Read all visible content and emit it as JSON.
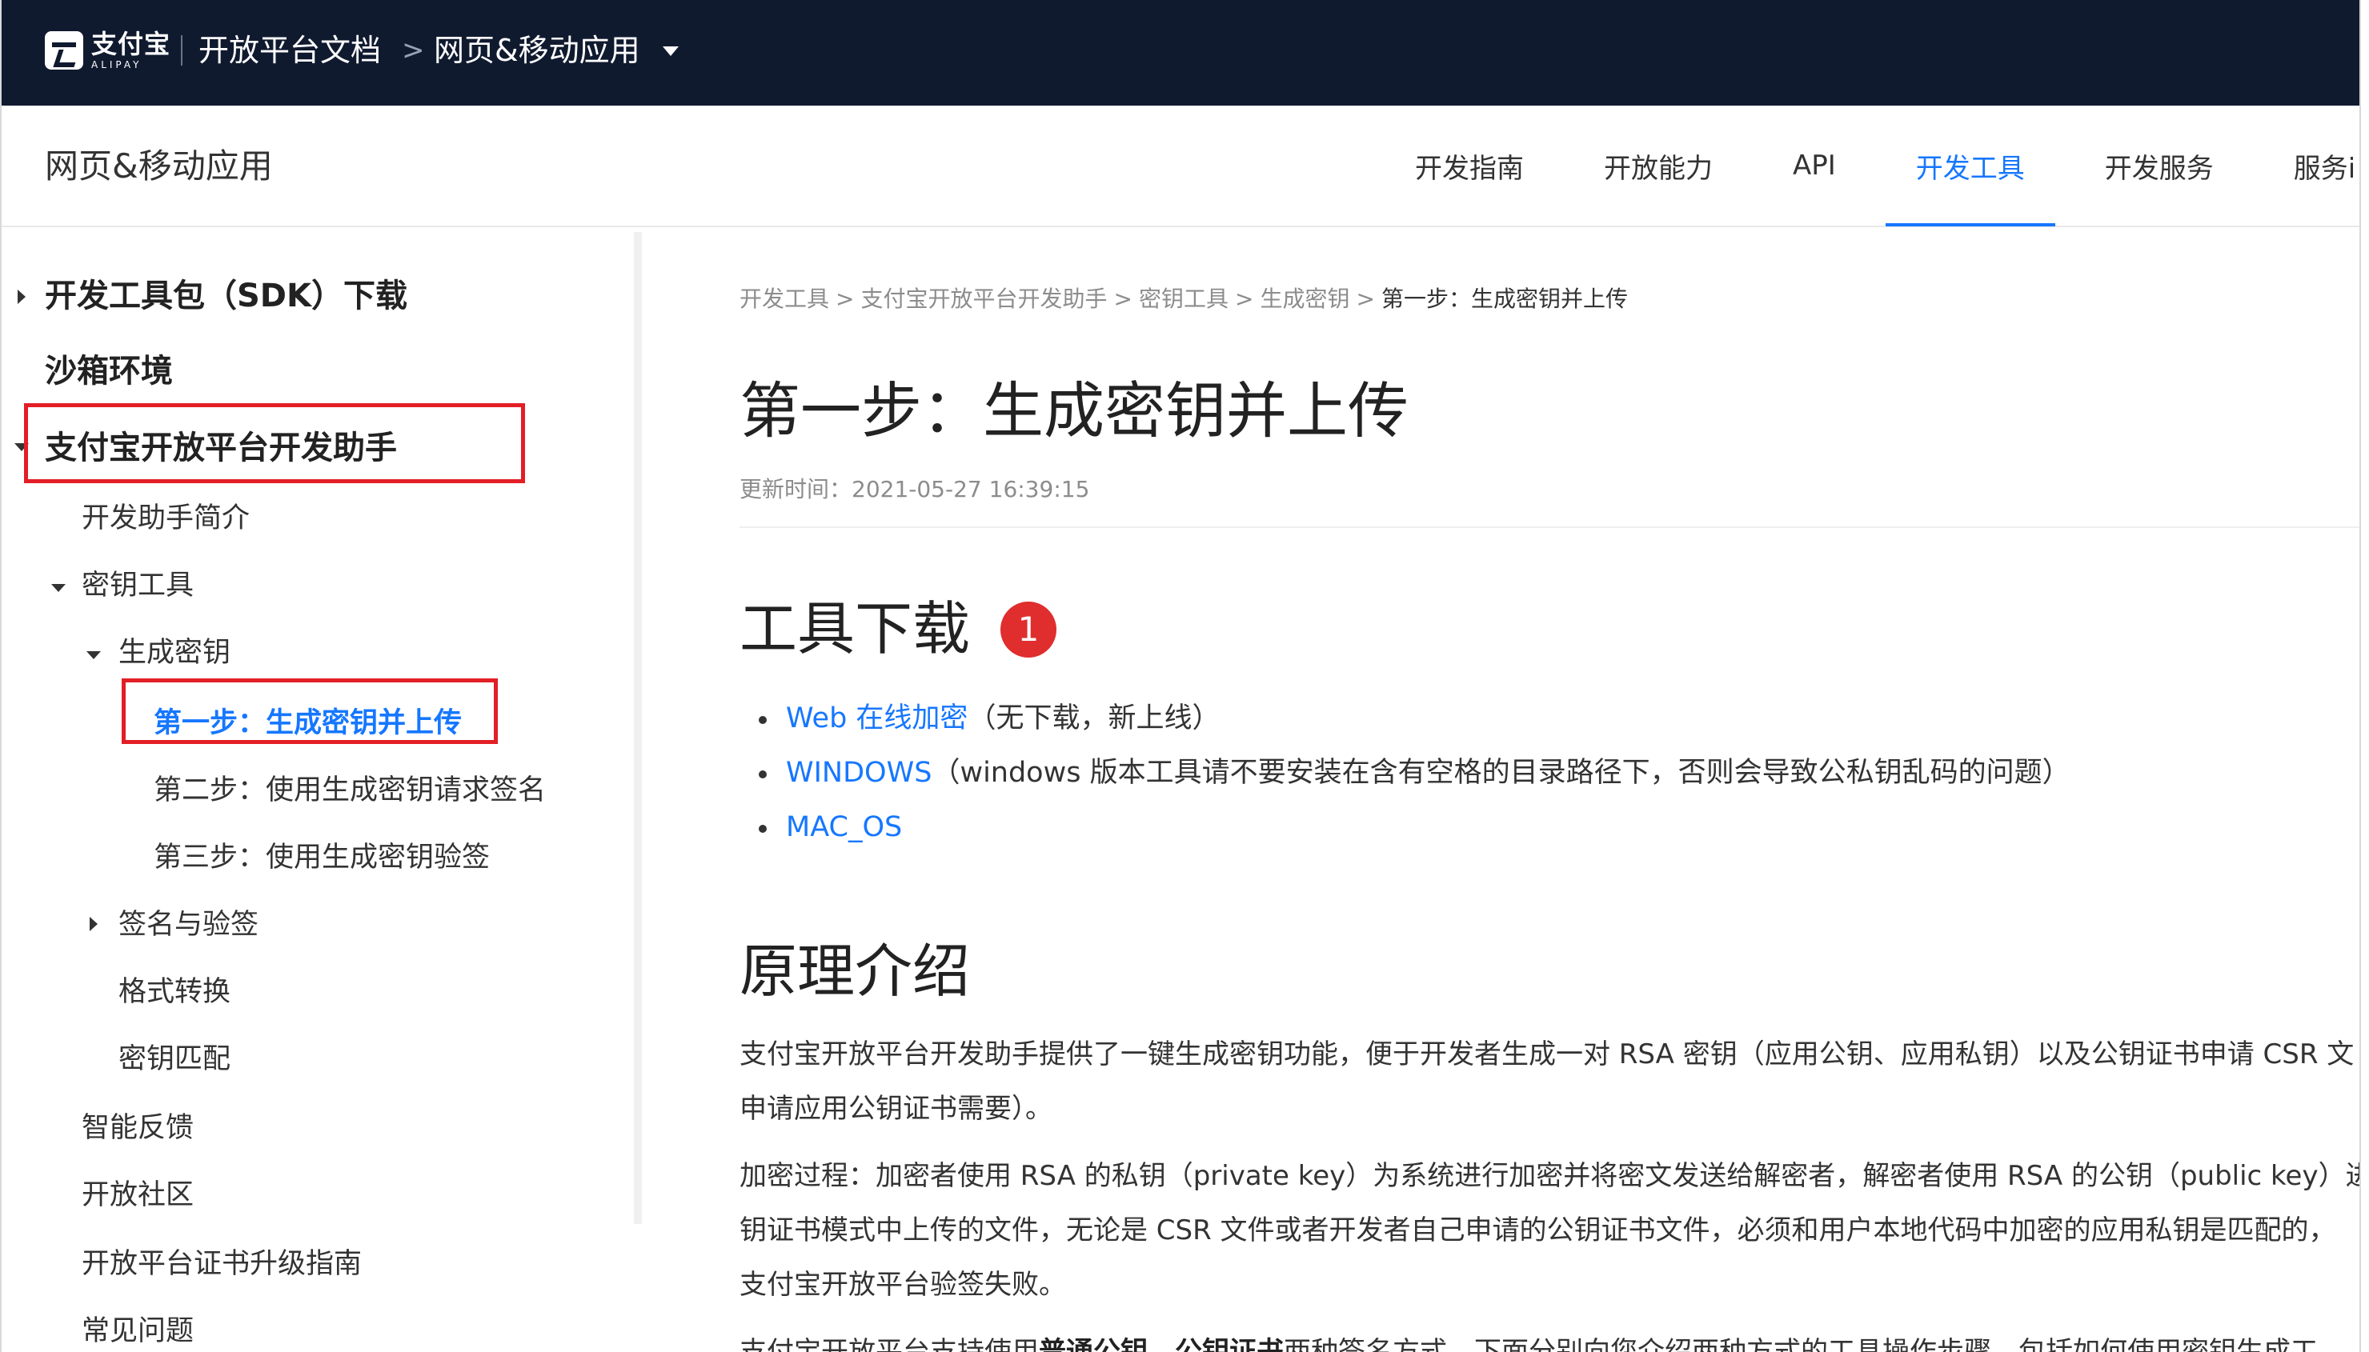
{
  "topbar": {
    "logo_cn": "支付宝",
    "logo_en": "ALIPAY",
    "title": "开放平台文档",
    "chevron": ">",
    "section": "网页&移动应用"
  },
  "header": {
    "title": "网页&移动应用",
    "nav": [
      "开发指南",
      "开放能力",
      "API",
      "开发工具",
      "开发服务",
      "服务i"
    ],
    "active_nav": "开发工具"
  },
  "sidebar": {
    "items": [
      {
        "label": "开发工具包（SDK）下载",
        "level": 0
      },
      {
        "label": "沙箱环境",
        "level": 0
      },
      {
        "label": "支付宝开放平台开发助手",
        "level": 0
      },
      {
        "label": "开发助手简介",
        "level": 1
      },
      {
        "label": "密钥工具",
        "level": 1
      },
      {
        "label": "生成密钥",
        "level": 2
      },
      {
        "label": "第一步：生成密钥并上传",
        "level": 3,
        "selected": true
      },
      {
        "label": "第二步：使用生成密钥请求签名",
        "level": 3
      },
      {
        "label": "第三步：使用生成密钥验签",
        "level": 3
      },
      {
        "label": "签名与验签",
        "level": 2
      },
      {
        "label": "格式转换",
        "level": 2
      },
      {
        "label": "密钥匹配",
        "level": 2
      },
      {
        "label": "智能反馈",
        "level": 1
      },
      {
        "label": "开放社区",
        "level": 1
      },
      {
        "label": "开放平台证书升级指南",
        "level": 1
      },
      {
        "label": "常见问题",
        "level": 1
      }
    ]
  },
  "content": {
    "breadcrumb": [
      "开发工具",
      "支付宝开放平台开发助手",
      "密钥工具",
      "生成密钥",
      "第一步：生成密钥并上传"
    ],
    "breadcrumb_sep": ">",
    "title": "第一步：生成密钥并上传",
    "updated": "更新时间：2021-05-27 16:39:15",
    "section1": {
      "heading": "工具下载",
      "badge": "1",
      "bullets": [
        {
          "link": "Web 在线加密",
          "note": "（无下载，新上线）"
        },
        {
          "link": "WINDOWS",
          "note": "（windows 版本工具请不要安装在含有空格的目录路径下，否则会导致公私钥乱码的问题）"
        },
        {
          "link": "MAC_OS",
          "note": ""
        }
      ]
    },
    "section2": {
      "heading": "原理介绍",
      "para1_line1": "支付宝开放平台开发助手提供了一键生成密钥功能，便于开发者生成一对 RSA 密钥（应用公钥、应用私钥）以及公钥证书申请 CSR 文",
      "para1_line2": "申请应用公钥证书需要）。",
      "para2_line1": "加密过程：加密者使用 RSA 的私钥（private key）为系统进行加密并将密文发送给解密者，解密者使用 RSA 的公钥（public key）进",
      "para2_line2": "钥证书模式中上传的文件，无论是 CSR 文件或者开发者自己申请的公钥证书文件，必须和用户本地代码中加密的应用私钥是匹配的，",
      "para2_line3": "支付宝开放平台验签失败。",
      "para3_pre": "支付宝开放平台支持使用",
      "para3_b1": "普通公钥",
      "para3_mid": "、",
      "para3_b2": "公钥证书",
      "para3_post": "两种签名方式，下面分别向您介绍两种方式的工具操作步骤，包括如何使用密钥生成工"
    }
  },
  "colors": {
    "topbar_bg": "#101a2f",
    "accent": "#1677ff",
    "highlight_box": "#e21e26",
    "badge": "#e02d2d"
  }
}
